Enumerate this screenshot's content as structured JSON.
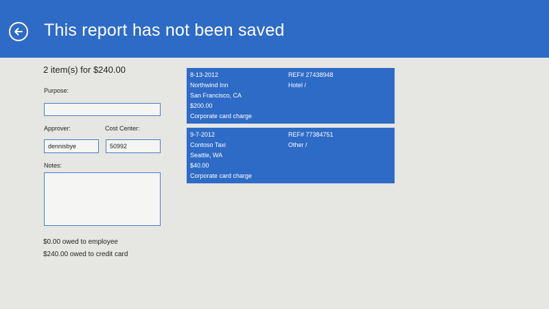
{
  "header": {
    "title": "This report has not been saved",
    "back_icon": "back-arrow-circle-icon"
  },
  "summary": "2 item(s) for $240.00",
  "form": {
    "purpose_label": "Purpose:",
    "purpose_value": "",
    "approver_label": "Approver:",
    "approver_value": "dennisbye",
    "cost_center_label": "Cost Center:",
    "cost_center_value": "50992",
    "notes_label": "Notes:",
    "notes_value": ""
  },
  "totals": {
    "employee": "$0.00 owed to employee",
    "credit_card": "$240.00 owed to credit card"
  },
  "expenses": [
    {
      "date": "8-13-2012",
      "ref": "REF# 27438948",
      "merchant": "Northwind Inn",
      "category": "Hotel  /",
      "location": "San Francisco, CA",
      "amount": "$200.00",
      "payment": "Corporate card charge"
    },
    {
      "date": "9-7-2012",
      "ref": "REF# 77384751",
      "merchant": "Contoso Taxi",
      "category": "Other  /",
      "location": "Seattle, WA",
      "amount": "$40.00",
      "payment": "Corporate card charge"
    }
  ],
  "colors": {
    "accent": "#2e6bc6",
    "background": "#e6e6e3",
    "field_border": "#4a7bc8"
  }
}
